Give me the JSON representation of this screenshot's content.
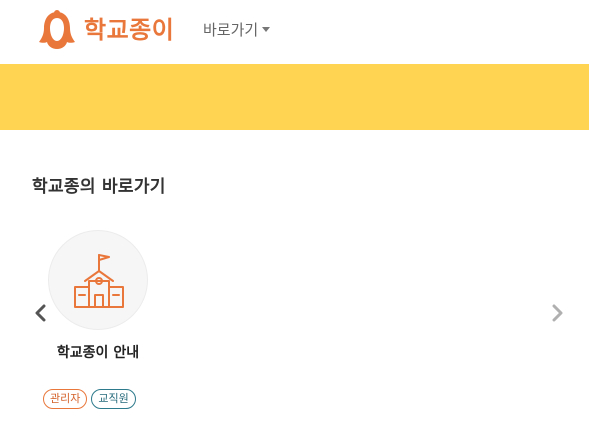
{
  "header": {
    "logo_text": "학교종이",
    "nav_shortcut_label": "바로가기"
  },
  "section": {
    "title": "학교종의 바로가기"
  },
  "cards": [
    {
      "title": "학교종이 안내",
      "icon": "school-building-icon",
      "badges": [
        "관리자",
        "교직원"
      ]
    }
  ],
  "colors": {
    "brand_orange": "#e9773b",
    "banner_yellow": "#fed452",
    "staff_teal": "#2d7a8c"
  },
  "icons": {
    "logo": "bell-logo-icon",
    "prev": "chevron-left-icon",
    "next": "chevron-right-icon",
    "nav_caret": "caret-down-icon"
  }
}
